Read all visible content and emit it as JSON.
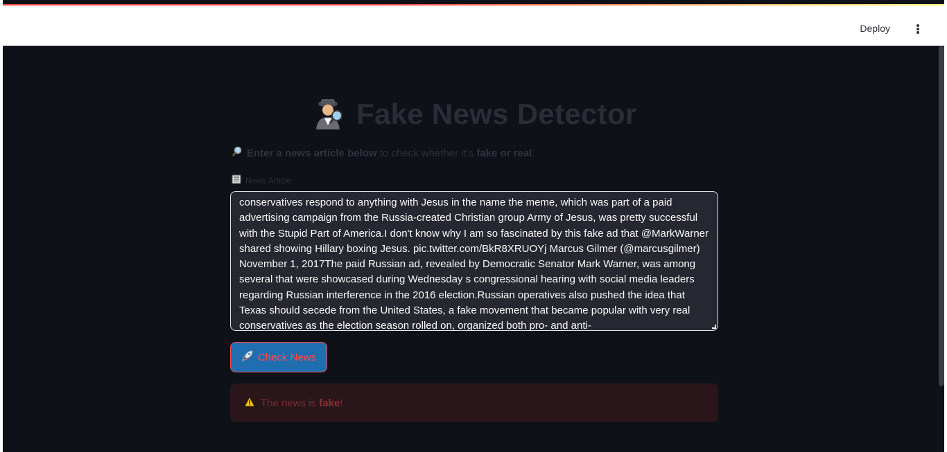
{
  "header": {
    "deploy_label": "Deploy",
    "menu_icon": "kebab-menu-icon"
  },
  "title": {
    "icon": "detective-icon",
    "text": "Fake News Detector"
  },
  "subtitle": {
    "icon": "magnifier-icon",
    "bold_part": "Enter a news article below",
    "middle_part": " to check whether it's ",
    "bold_end": "fake or real",
    "end": "."
  },
  "article": {
    "icon": "newspaper-icon",
    "label": "News Article",
    "value": "conservatives respond to anything with  Jesus  in the name the meme, which was part of a paid advertising campaign from the Russia-created Christian group  Army of Jesus,  was pretty successful with the Stupid Part of America.I don't know why I am so fascinated by this fake ad that @MarkWarner shared showing Hillary boxing Jesus. pic.twitter.com/BkR8XRUOYj  Marcus Gilmer (@marcusgilmer) November 1, 2017The paid Russian ad, revealed by Democratic Senator Mark Warner, was among several that were showcased during Wednesday s congressional hearing with social media leaders regarding Russian interference in the 2016 election.Russian operatives also pushed the idea that Texas should secede from the United States, a fake movement that became popular with very real conservatives as the election season rolled on, organized both pro- and anti-"
  },
  "check_button": {
    "icon": "rocket-icon",
    "label": "Check News"
  },
  "result": {
    "icon": "warning-icon",
    "prefix": "The news is ",
    "verdict": "fake",
    "suffix": "!",
    "color": "#ff4b4b"
  }
}
